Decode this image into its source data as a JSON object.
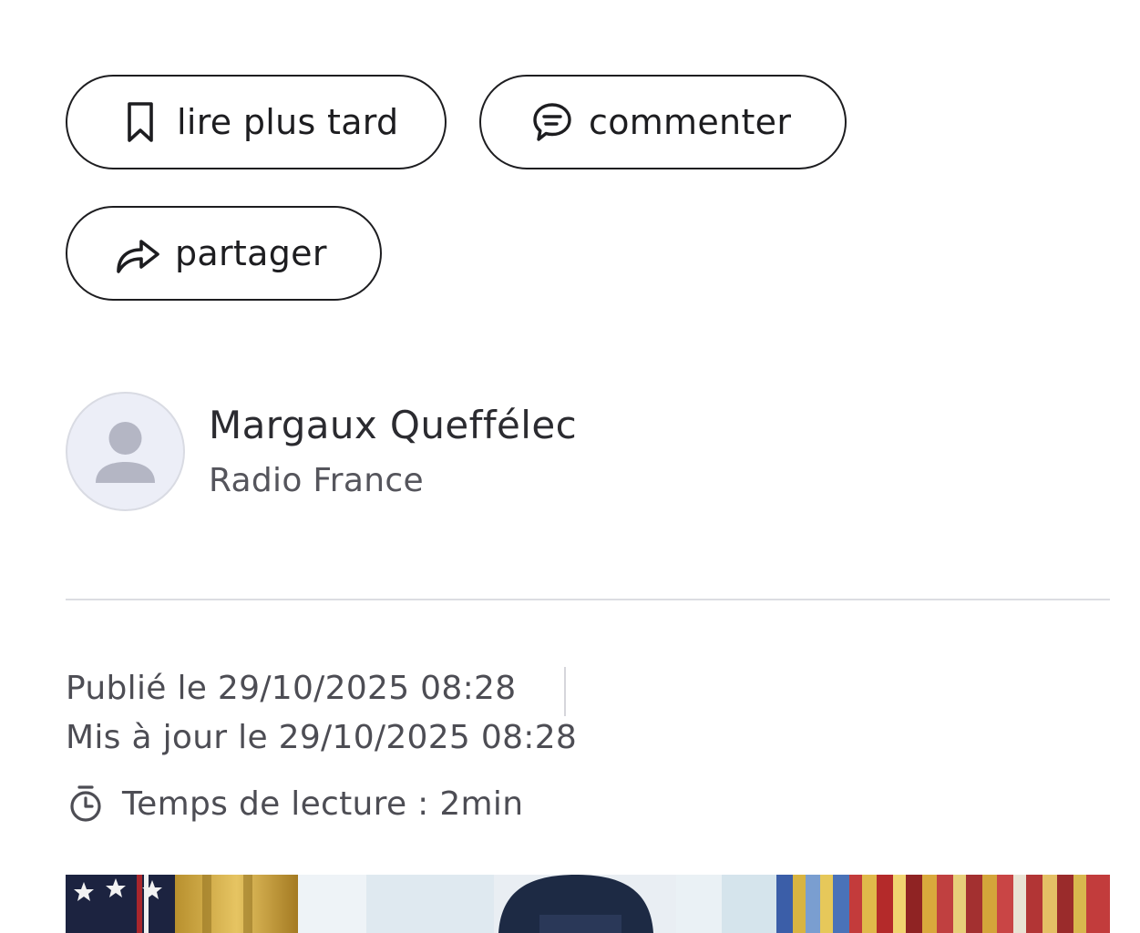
{
  "actions": {
    "read_later_label": "lire plus tard",
    "comment_label": "commenter",
    "share_label": "partager",
    "icons": {
      "read_later": "bookmark-icon",
      "comment": "comment-bubble-icon",
      "share": "share-arrow-icon"
    }
  },
  "author": {
    "name": "Margaux Queffélec",
    "organization": "Radio France",
    "avatar_icon": "user-placeholder-icon"
  },
  "meta": {
    "published": "Publié le 29/10/2025 08:28",
    "updated": "Mis à jour le 29/10/2025 08:28",
    "reading_time": "Temps de lecture : 2min",
    "reading_icon": "stopwatch-icon"
  },
  "colors": {
    "text_primary": "#1d1d20",
    "text_secondary": "#4d4d54",
    "divider": "#dcdde2",
    "avatar_bg": "#eceef7",
    "avatar_figure": "#b4b6c4"
  }
}
